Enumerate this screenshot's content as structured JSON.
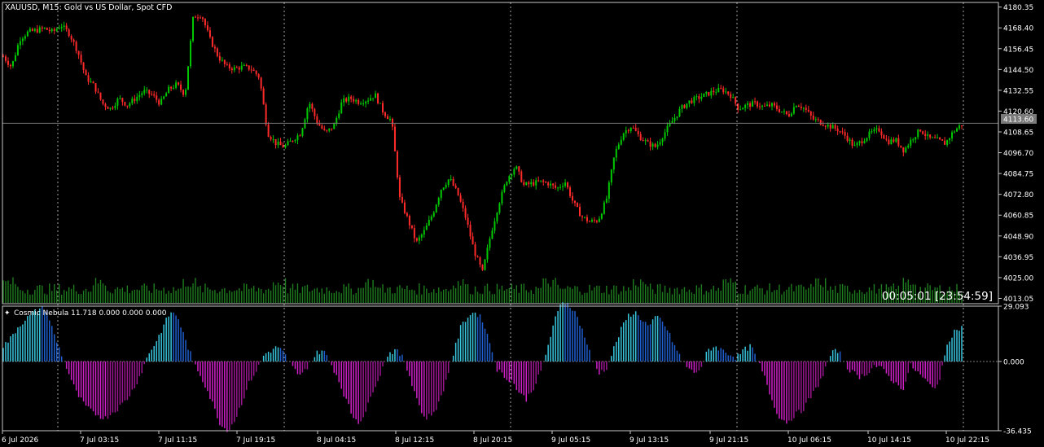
{
  "symbol_caption": "XAUUSD, M15:  Gold vs US Dollar, Spot CFD",
  "indicator_caption": "Cosmic Nebula 11.718 0.000 0.000 0.000",
  "timer_text": "00:05:01 [23:54:59]",
  "current_price_label": "4113.60",
  "colors": {
    "background": "#000000",
    "frame": "#c8c8c8",
    "candle_up": "#00c800",
    "candle_down": "#ff2a2a",
    "volume": "#1e7d1e",
    "grid_vline": "#ffffff",
    "current_price_line": "#7a7a7a",
    "hist_pos_light": "#38c7df",
    "hist_pos_dark": "#1f5fd0",
    "hist_neg": "#d020c8",
    "hist_neg_dark": "#9a1790"
  },
  "chart_data": [
    {
      "type": "candlestick",
      "y_tick_labels": [
        "4180.35",
        "4168.40",
        "4156.45",
        "4144.50",
        "4132.55",
        "4120.60",
        "4108.65",
        "4096.70",
        "4084.75",
        "4072.80",
        "4060.85",
        "4048.90",
        "4036.95",
        "4025.00",
        "4013.05"
      ],
      "ylim": [
        4010.0,
        4183.0
      ],
      "x_tick_labels": [
        "6 Jul 2026",
        "7 Jul 03:15",
        "7 Jul 11:15",
        "7 Jul 19:15",
        "8 Jul 04:15",
        "8 Jul 12:15",
        "8 Jul 20:15",
        "9 Jul 05:15",
        "9 Jul 13:15",
        "9 Jul 21:15",
        "10 Jul 06:15",
        "10 Jul 14:15",
        "10 Jul 22:15"
      ],
      "current_price": 4113.6,
      "close_path": [
        4152,
        4146,
        4162,
        4166,
        4167,
        4168,
        4166,
        4170,
        4165,
        4155,
        4140,
        4135,
        4125,
        4122,
        4128,
        4124,
        4128,
        4132,
        4130,
        4125,
        4133,
        4136,
        4130,
        4175,
        4176,
        4162,
        4152,
        4146,
        4145,
        4146,
        4145,
        4140,
        4108,
        4102,
        4100,
        4104,
        4108,
        4126,
        4114,
        4108,
        4112,
        4126,
        4128,
        4126,
        4127,
        4130,
        4120,
        4115,
        4070,
        4058,
        4045,
        4052,
        4062,
        4076,
        4082,
        4073,
        4059,
        4040,
        4028,
        4050,
        4068,
        4082,
        4089,
        4078,
        4079,
        4080,
        4079,
        4076,
        4080,
        4068,
        4060,
        4057,
        4058,
        4070,
        4096,
        4108,
        4112,
        4106,
        4102,
        4100,
        4108,
        4115,
        4122,
        4126,
        4128,
        4130,
        4132,
        4133,
        4130,
        4122,
        4124,
        4125,
        4123,
        4124,
        4121,
        4118,
        4125,
        4122,
        4116,
        4114,
        4112,
        4110,
        4106,
        4100,
        4104,
        4108,
        4110,
        4103,
        4104,
        4098,
        4105,
        4110,
        4105,
        4104,
        4102,
        4109,
        4113
      ]
    },
    {
      "type": "bar",
      "name": "Cosmic Nebula",
      "y_tick_labels": [
        "29.093",
        "0.000",
        "-36.435"
      ],
      "ylim": [
        -36.435,
        29.093
      ],
      "value_path": [
        8,
        12,
        18,
        22,
        25,
        28,
        27,
        14,
        4,
        -6,
        -16,
        -22,
        -26,
        -28,
        -30,
        -27,
        -24,
        -20,
        -14,
        -6,
        4,
        10,
        18,
        26,
        24,
        12,
        2,
        -6,
        -14,
        -24,
        -34,
        -36,
        -30,
        -20,
        -10,
        -4,
        4,
        6,
        8,
        2,
        -4,
        -8,
        -2,
        4,
        6,
        0,
        -8,
        -18,
        -28,
        -32,
        -26,
        -14,
        -6,
        4,
        6,
        2,
        -8,
        -20,
        -30,
        -28,
        -22,
        -10,
        4,
        18,
        24,
        26,
        22,
        10,
        -4,
        -8,
        -10,
        -16,
        -20,
        -14,
        -6,
        8,
        22,
        32,
        30,
        24,
        14,
        2,
        -6,
        -4,
        6,
        16,
        24,
        26,
        22,
        18,
        24,
        20,
        12,
        4,
        -2,
        -6,
        -4,
        6,
        8,
        6,
        4,
        2,
        6,
        8,
        0,
        -10,
        -22,
        -30,
        -32,
        -28,
        -26,
        -20,
        -14,
        -6,
        4,
        6,
        -2,
        -6,
        -8,
        -6,
        -2,
        -4,
        -8,
        -12,
        -14,
        -2,
        -6,
        -10,
        -14,
        -10,
        10,
        16,
        18
      ]
    }
  ]
}
